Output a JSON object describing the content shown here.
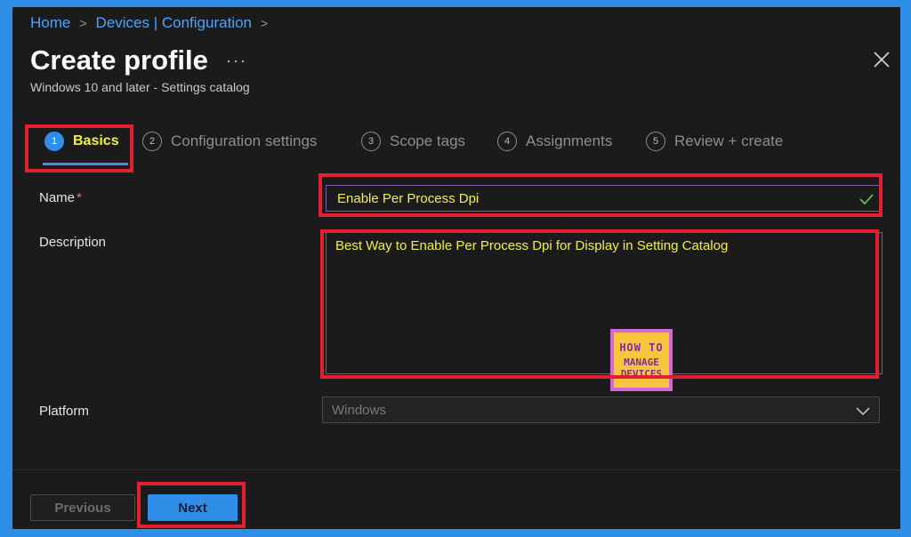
{
  "breadcrumb": {
    "home": "Home",
    "section": "Devices | Configuration",
    "sep": ">"
  },
  "header": {
    "title": "Create profile",
    "more": "···",
    "subtitle": "Windows 10 and later - Settings catalog"
  },
  "tabs": [
    {
      "num": "1",
      "label": "Basics"
    },
    {
      "num": "2",
      "label": "Configuration settings"
    },
    {
      "num": "3",
      "label": "Scope tags"
    },
    {
      "num": "4",
      "label": "Assignments"
    },
    {
      "num": "5",
      "label": "Review + create"
    }
  ],
  "form": {
    "name_label": "Name",
    "required_mark": "*",
    "name_value": "Enable Per Process Dpi",
    "description_label": "Description",
    "description_value": "Best Way to Enable Per Process Dpi for Display in Setting Catalog",
    "platform_label": "Platform",
    "platform_value": "Windows"
  },
  "watermark": {
    "line1": "HOW TO",
    "line2": "MANAGE",
    "line3": "DEVICES"
  },
  "footer": {
    "previous_label": "Previous",
    "next_label": "Next"
  },
  "colors": {
    "accent": "#2f8fe8",
    "highlight_text": "#f2f03a",
    "annotation_red": "#e0202f"
  }
}
